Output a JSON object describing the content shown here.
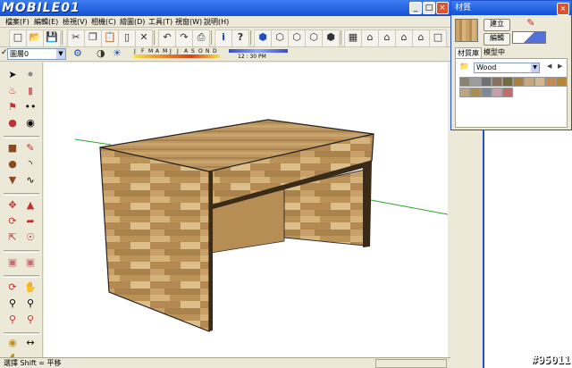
{
  "title_bar": {
    "logo_text": "MOBILE01",
    "minimize": "_",
    "maximize": "□",
    "close": "×"
  },
  "menu": [
    "檔案(F)",
    "編輯(E)",
    "檢視(V)",
    "相機(C)",
    "繪圖(D)",
    "工具(T)",
    "視窗(W)",
    "說明(H)"
  ],
  "toolbar2": {
    "layer_label": "圖層0",
    "months": [
      "J",
      "F",
      "M",
      "A",
      "M",
      "J",
      "J",
      "A",
      "S",
      "O",
      "N",
      "D"
    ],
    "time_label": "12 : 30 PM"
  },
  "status_bar": {
    "text": "選擇  Shift = 平移"
  },
  "materials_panel": {
    "title": "材質",
    "create_label": "建立",
    "edit_label": "編輯",
    "tabs": [
      "材質庫",
      "模型中"
    ],
    "library_selected": "Wood",
    "swatch_colors": [
      "#8a8370",
      "#9c9c9c",
      "#6f7177",
      "#8a6f5a",
      "#746b3e",
      "#a87f3e",
      "#c8a878",
      "#d2b88c",
      "#c48a52",
      "#b8862c",
      "#bfa57e",
      "#a89050",
      "#7f8a98",
      "#c5a0a8",
      "#c06c6c"
    ]
  },
  "badge": {
    "text": "#95011"
  },
  "colors": {
    "title_blue": "#1f5ee3",
    "panel_bg": "#ece9d8",
    "axis_green": "#2aa82a"
  }
}
